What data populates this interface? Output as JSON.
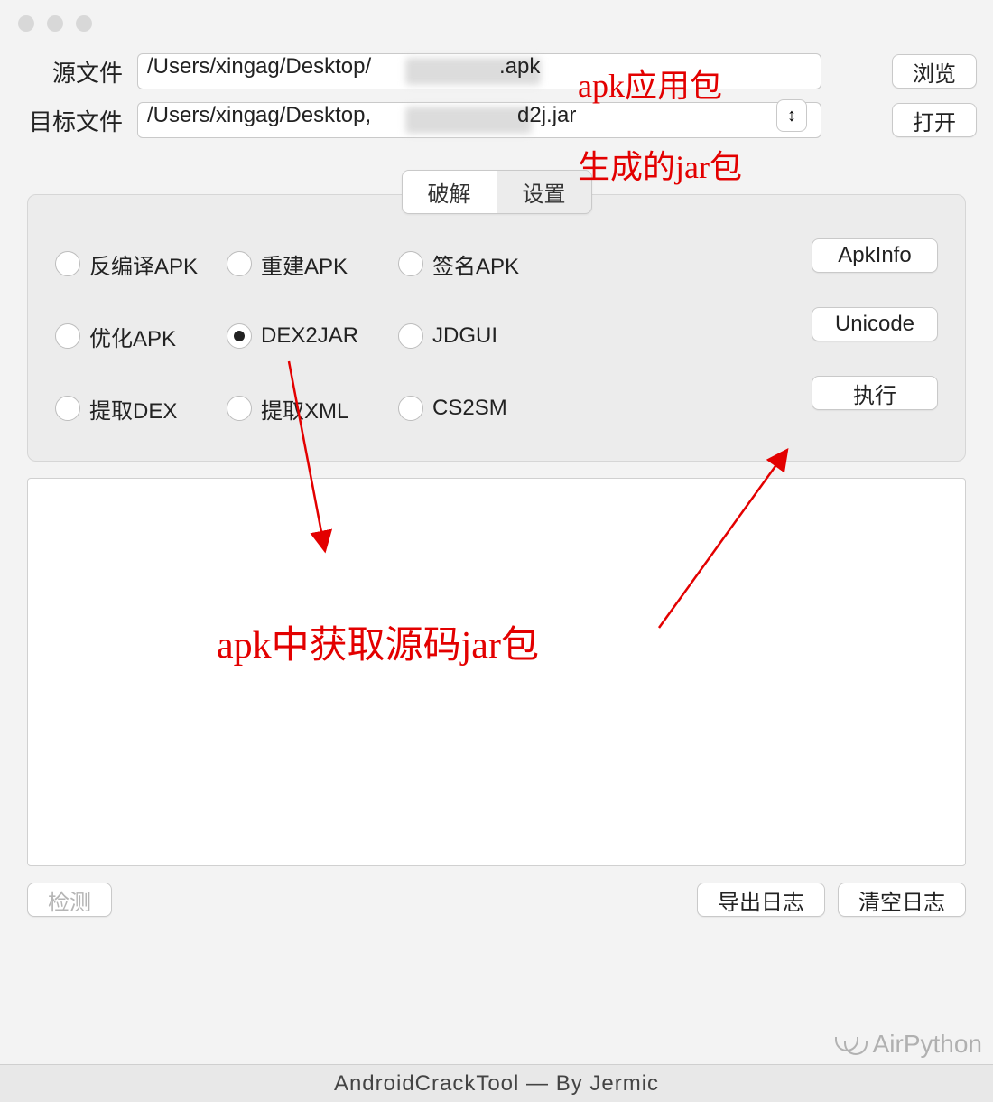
{
  "labels": {
    "source": "源文件",
    "target": "目标文件"
  },
  "inputs": {
    "source_prefix": "/Users/xingag/Desktop/",
    "source_suffix": ".apk",
    "target_prefix": "/Users/xingag/Desktop,",
    "target_suffix": "d2j.jar"
  },
  "buttons": {
    "browse": "浏览",
    "open": "打开",
    "swap": "↕",
    "apkinfo": "ApkInfo",
    "unicode": "Unicode",
    "run": "执行",
    "detect": "检测",
    "export_log": "导出日志",
    "clear_log": "清空日志"
  },
  "tabs": {
    "crack": "破解",
    "settings": "设置"
  },
  "radios": [
    "反编译APK",
    "重建APK",
    "签名APK",
    "优化APK",
    "DEX2JAR",
    "JDGUI",
    "提取DEX",
    "提取XML",
    "CS2SM"
  ],
  "radio_selected_index": 4,
  "annotations": {
    "apk_pkg": "apk应用包",
    "jar_pkg": "生成的jar包",
    "center": "apk中获取源码jar包"
  },
  "watermark": "AirPython",
  "footer": "AndroidCrackTool  —  By  Jermic"
}
